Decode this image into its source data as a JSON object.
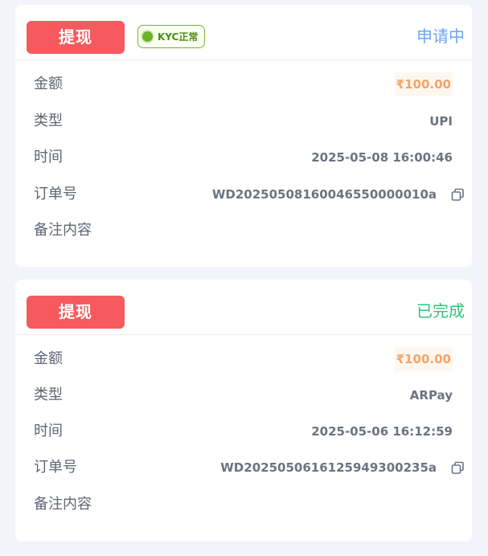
{
  "records": [
    {
      "type_label": "提现",
      "kyc_badge": "KYC正常",
      "status": "申请中",
      "status_color": "#6ba6f2",
      "amount_label": "金额",
      "amount": "₹100.00",
      "type_field_label": "类型",
      "type_value": "UPI",
      "time_label": "时间",
      "time": "2025-05-08 16:00:46",
      "order_label": "订单号",
      "order_no": "WD20250508160046550000010a",
      "remark_label": "备注内容",
      "remark": ""
    },
    {
      "type_label": "提现",
      "status": "已完成",
      "status_color": "#2fc37c",
      "amount_label": "金额",
      "amount": "₹100.00",
      "type_field_label": "类型",
      "type_value": "ARPay",
      "time_label": "时间",
      "time": "2025-05-06 16:12:59",
      "order_label": "订单号",
      "order_no": "WD20250506161259493002​35a",
      "remark_label": "备注内容",
      "remark": ""
    }
  ],
  "colors": {
    "tag_bg": "#f65a5e",
    "amount": "#f5a468",
    "kyc_green": "#6fb02a"
  },
  "icons": {
    "copy": "copy-icon",
    "kyc_status": "status-dot-icon"
  }
}
